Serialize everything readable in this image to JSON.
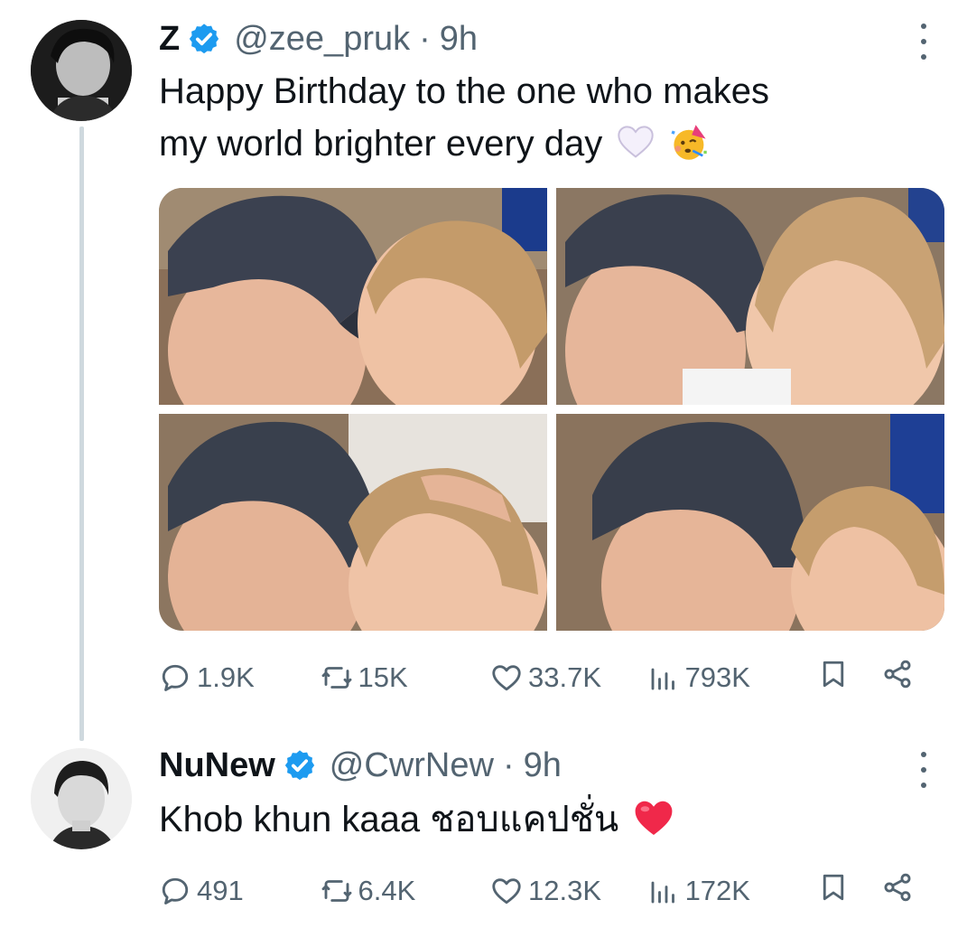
{
  "tweet": {
    "author_name": "Z",
    "handle": "@zee_pruk",
    "separator": "·",
    "time": "9h",
    "text_line1": "Happy Birthday to the one who makes",
    "text_line2": "my world brighter every day",
    "emojis": [
      "white-heart-icon",
      "partying-face-icon"
    ],
    "photos": [
      "photo-1",
      "photo-2",
      "photo-3",
      "photo-4"
    ],
    "stats": {
      "replies": "1.9K",
      "reposts": "15K",
      "likes": "33.7K",
      "views": "793K"
    }
  },
  "reply": {
    "author_name": "NuNew",
    "handle": "@CwrNew",
    "separator": "·",
    "time": "9h",
    "text": "Khob khun kaaa ชอบแคปชั่น",
    "emoji": "red-heart-icon",
    "stats": {
      "replies": "491",
      "reposts": "6.4K",
      "likes": "12.3K",
      "views": "172K"
    }
  },
  "colors": {
    "text_primary": "#0f1419",
    "text_secondary": "#536471",
    "verified_blue": "#1d9bf0",
    "thread_line": "#cfd9de",
    "red_heart": "#f0284a"
  }
}
